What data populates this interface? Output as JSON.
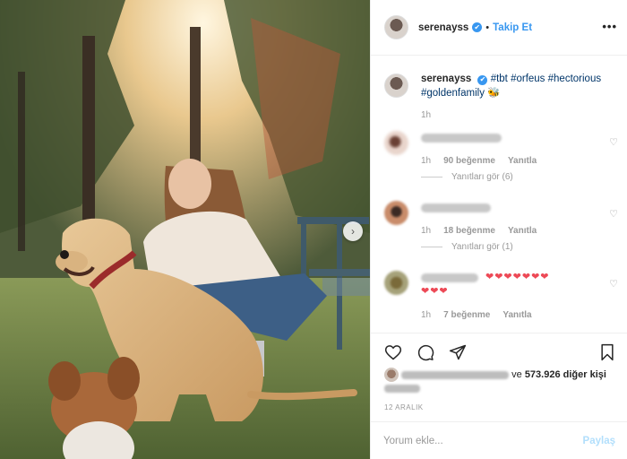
{
  "post": {
    "username": "serenayss",
    "follow_label": "Takip Et",
    "dot": "•",
    "more_label": "•••",
    "verified_mark": "✔"
  },
  "caption": {
    "username": "serenayss",
    "hashtags": [
      "#tbt",
      "#orfeus",
      "#hectorious",
      "#goldenfamily"
    ],
    "emoji": "🐝",
    "time": "1h"
  },
  "comments": [
    {
      "time": "1h",
      "likes": "90 beğenme",
      "reply_label": "Yanıtla",
      "replies_label": "Yanıtları gör (6)"
    },
    {
      "time": "1h",
      "likes": "18 beğenme",
      "reply_label": "Yanıtla",
      "replies_label": "Yanıtları gör (1)"
    },
    {
      "time": "1h",
      "likes": "7 beğenme",
      "reply_label": "Yanıtla",
      "hearts": "❤❤❤❤❤❤❤"
    }
  ],
  "likes_summary": {
    "connector": "ve",
    "count_label": "573.926 diğer kişi",
    "suffix": "beğendi"
  },
  "date": "12 ARALIK",
  "comment_input": {
    "placeholder": "Yorum ekle...",
    "post_label": "Paylaş"
  },
  "icons": [
    "heart-icon",
    "comment-icon",
    "share-icon",
    "bookmark-icon",
    "more-options-icon",
    "verified-icon",
    "next-arrow-icon"
  ],
  "colors": {
    "accent": "#3897f0",
    "heart": "#ed4956",
    "muted": "#999999"
  }
}
